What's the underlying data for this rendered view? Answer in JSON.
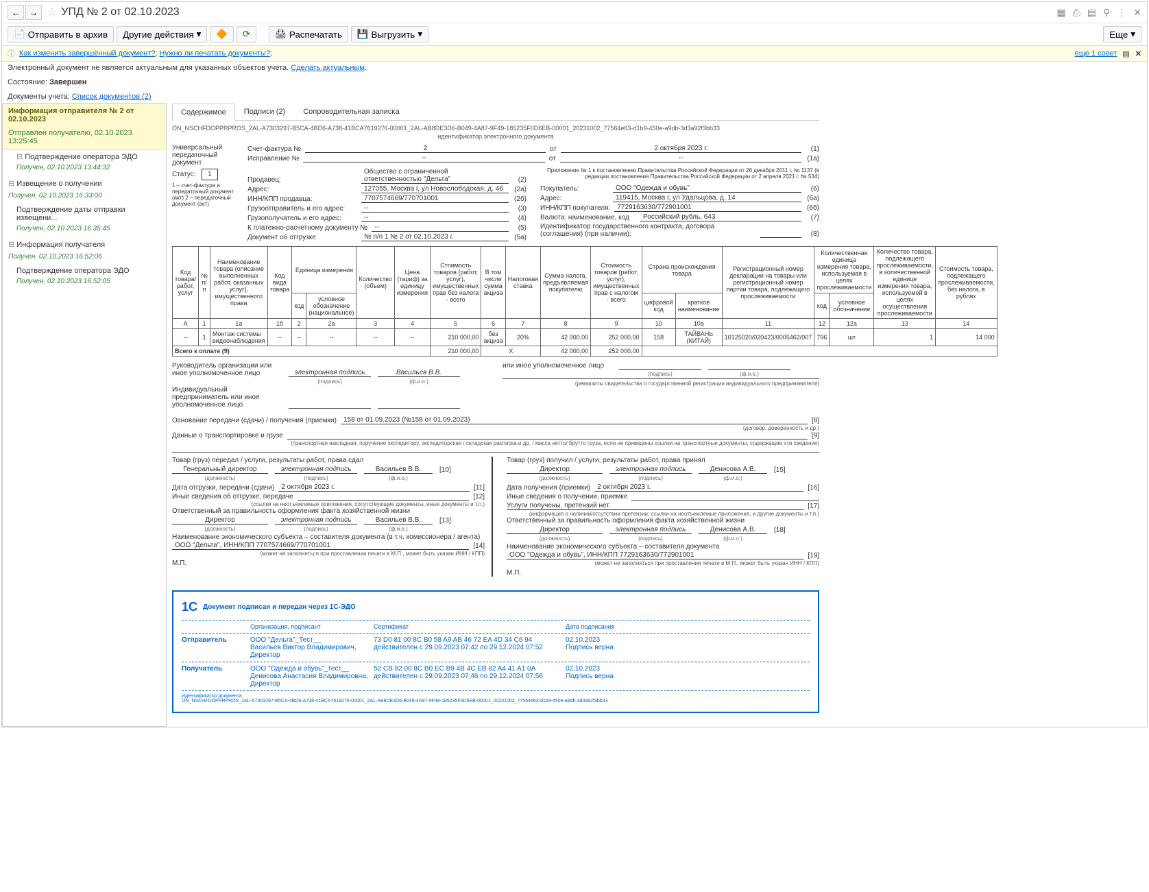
{
  "title": "УПД № 2 от 02.10.2023",
  "toolbar": {
    "archive": "Отправить в архив",
    "other": "Другие действия",
    "print": "Распечатать",
    "export": "Выгрузить",
    "more": "Еще"
  },
  "warning": {
    "link1": "Как изменить завершённый документ?",
    "link2": "Нужно ли печатать документы?",
    "right": "еще 1 совет"
  },
  "info_line": {
    "text": "Электронный документ не является актуальным для указанных объектов учета. ",
    "link": "Сделать актуальным"
  },
  "status": {
    "label": "Состояние:",
    "value": "Завершен"
  },
  "docs": {
    "label": "Документы учета:",
    "link": "Список документов (2)"
  },
  "sidebar": {
    "header": "Информация отправителя № 2 от 02.10.2023",
    "sub": "Отправлен получателю, 02.10.2023 13:25:45",
    "items": [
      {
        "title": "Подтверждение оператора ЭДО",
        "time": "Получен, 02.10.2023 13:44:32"
      },
      {
        "title": "Извещение о получении",
        "time": "Получен, 02.10.2023 16:33:00"
      },
      {
        "title": "Подтверждение даты отправки извещени...",
        "time": "Получен, 02.10.2023 16:35:45"
      },
      {
        "title": "Информация получателя",
        "time": "Получен, 02.10.2023 16:52:06"
      },
      {
        "title": "Подтверждение оператора ЭДО",
        "time": "Получен, 02.10.2023 16:52:05"
      }
    ]
  },
  "tabs": [
    "Содержимое",
    "Подписи (2)",
    "Сопроводительная записка"
  ],
  "doc_id": "ON_NSCHFDOPPRPROS_2AL-A7303297-B5CA-4BD6-A738-41BCA7619276-00001_2AL-AB8DE3D6-B049-4A87-9F49-185235F0D6EB-00001_20231002_77564e63-d1b9-450e-a9db-3d3a92f3bb33",
  "doc_id_label": "идентификатор электронного документа",
  "header": {
    "upd_label": "Универсальный передаточный документ",
    "status_label": "Статус:",
    "status_val": "1",
    "status_note": "1 – счет-фактура и передаточный документ (акт) 2 – передаточный документ (акт)",
    "invoice_label": "Счет-фактура №",
    "invoice_num": "2",
    "invoice_date_label": "от",
    "invoice_date": "2 октября 2023 г.",
    "correction_label": "Исправление №",
    "correction_num": "--",
    "correction_date": "--",
    "appendix": "Приложение № 1 к постановлению Правительства Российской Федерации от 26 декабря 2011 г. № 1137 (в редакции постановления Правительства Российской Федерации от 2 апреля 2021 г. № 534)"
  },
  "seller": {
    "label": "Продавец:",
    "name": "Общество с ограниченной ответственностью \"Дельта\"",
    "addr_label": "Адрес:",
    "addr": "127055, Москва г, ул Новослободская, д. 46",
    "inn_label": "ИНН/КПП продавца:",
    "inn": "7707574669/770701001",
    "shipper_label": "Грузоотправитель и его адрес:",
    "shipper": "--",
    "consignee_label": "Грузополучатель и его адрес:",
    "consignee": "--",
    "payment_label": "К платежно-расчетному документу №",
    "payment": "--",
    "shipdoc_label": "Документ об отгрузке",
    "shipdoc": "№ п/п 1 № 2 от 02.10.2023 г."
  },
  "buyer": {
    "label": "Покупатель:",
    "name": "ООО \"Одежда и обувь\"",
    "addr_label": "Адрес:",
    "addr": "119415, Москва г, ул Удальцова, д. 14",
    "inn_label": "ИНН/КПП покупателя:",
    "inn": "7729163630/772901001",
    "currency_label": "Валюта: наименование, код",
    "currency": "Российский рубль, 643",
    "contract_label": "Идентификатор государственного контракта, договора (соглашения) (при наличии):"
  },
  "nums": [
    "(1)",
    "(1а)",
    "(2)",
    "(2а)",
    "(2б)",
    "(3)",
    "(4)",
    "(5)",
    "(5а)",
    "(6)",
    "(6а)",
    "(6б)",
    "(7)",
    "(8)"
  ],
  "table": {
    "headers": {
      "h1": "Код товара/ работ, услуг",
      "h2": "№ п/п",
      "h3": "Наименование товара (описание выполненных работ, оказанных услуг), имущественного права",
      "h4": "Код вида товара",
      "h5": "Единица измерения",
      "h5a": "код",
      "h5b": "условное обозначение (национальное)",
      "h6": "Количество (объем)",
      "h7": "Цена (тариф) за единицу измерения",
      "h8": "Стоимость товаров (работ, услуг), имущественных прав без налога - всего",
      "h9": "В том числе сумма акциза",
      "h10": "Налоговая ставка",
      "h11": "Сумма налога, предъявляемая покупателю",
      "h12": "Стоимость товаров (работ, услуг), имущественных прав с налогом - всего",
      "h13": "Страна происхождения товара",
      "h13a": "цифровой код",
      "h13b": "краткое наименование",
      "h14": "Регистрационный номер декларации на товары или регистрационный номер партии товара, подлежащего прослеживаемости",
      "h15": "Количественная единица измерения товара, используемая в целях прослеживаемости",
      "h15a": "код",
      "h15b": "условное обозначение",
      "h16": "Количество товара, подлежащего прослеживаемости, в количественной единице измерения товара, используемой в целях осуществления прослеживаемости",
      "h17": "Стоимость товара, подлежащего прослеживаемости, без налога, в рублях"
    },
    "cols": [
      "А",
      "1",
      "1а",
      "1б",
      "2",
      "2а",
      "3",
      "4",
      "5",
      "6",
      "7",
      "8",
      "9",
      "10",
      "10а",
      "11",
      "12",
      "12а",
      "13",
      "14"
    ],
    "row": {
      "code": "--",
      "num": "1",
      "name": "Монтаж системы видеонаблюдения",
      "kind": "--",
      "ucode": "--",
      "uname": "--",
      "qty": "--",
      "price": "--",
      "cost": "210 000,00",
      "excise": "без акциза",
      "rate": "20%",
      "tax": "42 000,00",
      "total": "252 000,00",
      "ccode": "158",
      "cname": "ТАЙВАНЬ (КИТАЙ)",
      "decl": "10125020/020423/0005462/007",
      "tcode": "796",
      "tname": "шт",
      "tqty": "1",
      "tcost": "14 000"
    },
    "total_label": "Всего к оплате (9)",
    "total_cost": "210 000,00",
    "total_x": "Х",
    "total_tax": "42 000,00",
    "total_sum": "252 000,00"
  },
  "sign": {
    "head_label": "Руководитель организации или иное уполномоченное лицо",
    "head_sig": "электронная подпись",
    "head_name": "Васильев В.В.",
    "other_label": "или иное уполномоченное лицо",
    "ip_label": "Индивидуальный предприниматель или иное уполномоченное лицо",
    "ip_note": "(реквизиты свидетельства о государственной регистрации индивидуального предпринимателя)",
    "sig_cap": "(подпись)",
    "fio_cap": "(ф.и.о.)"
  },
  "transfer": {
    "basis_label": "Основание передачи (сдачи) / получения (приемки)",
    "basis_val": "158 от 01.09.2023 (№158 от 01.09.2023)",
    "basis_note": "(договор; доверенность и др.)",
    "transport_label": "Данные о транспортировке и грузе",
    "transport_note": "(транспортная накладная, поручение экспедитору, экспедиторская / складская расписка и др. / масса нетто/ брутто груза, если не приведены ссылки на транспортные документы, содержащие эти сведения)",
    "left": {
      "title": "Товар (груз) передал / услуги, результаты работ, права сдал",
      "pos": "Генеральный директор",
      "sig": "электронная подпись",
      "name": "Васильев В.В.",
      "date_label": "Дата отгрузки, передачи (сдачи)",
      "date": "2 октября 2023 г.",
      "other_label": "Иные сведения об отгрузке, передаче",
      "other_note": "(ссылки на неотъемлемые приложения, сопутствующие документы, иные документы и т.п.)",
      "resp_label": "Ответственный за правильность оформления факта хозяйственной жизни",
      "resp_pos": "Директор",
      "resp_sig": "электронная подпись",
      "resp_name": "Васильев В.В.",
      "entity_label": "Наименование экономического субъекта – составителя документа (в т.ч. комиссионера / агента)",
      "entity": "ООО \"Дельта\", ИНН/КПП 7707574669/770701001",
      "entity_note": "(может не заполняться при проставлении печати в М.П., может быть указан ИНН / КПП)",
      "mp": "М.П."
    },
    "right": {
      "title": "Товар (груз) получил / услуги, результаты работ, права принял",
      "pos": "Директор",
      "sig": "электронная подпись",
      "name": "Денисова А.В.",
      "date_label": "Дата получения (приемки)",
      "date": "2 октября 2023 г.",
      "other_label": "Иные сведения о получении, приемке",
      "other2": "Услуги получены, претензий нет.",
      "other_note": "(информация о наличии/отсутствии претензии; ссылки на неотъемлемые приложения, и другие документы и т.п.)",
      "resp_label": "Ответственный за правильность оформления факта хозяйственной жизни",
      "resp_pos": "Директор",
      "resp_sig": "электронная подпись",
      "resp_name": "Денисова А.В.",
      "entity_label": "Наименование экономического субъекта – составителя документа",
      "entity": "ООО \"Одежда и обувь\", ИНН/КПП 7729163630/772901001",
      "entity_note": "(может не заполняться при проставлении печати в М.П., может быть указан ИНН / КПП)",
      "mp": "М.П."
    },
    "nums": [
      "[8]",
      "[9]",
      "[10]",
      "[11]",
      "[12]",
      "[13]",
      "[14]",
      "[15]",
      "[16]",
      "[17]",
      "[18]",
      "[19]"
    ],
    "pos_cap": "(должность)",
    "sig_cap": "(подпись)",
    "fio_cap": "(ф.и.о.)"
  },
  "sigbox": {
    "title": "Документ подписан и передан через 1С-ЭДО",
    "h_org": "Организация, подписант",
    "h_cert": "Сертификат",
    "h_date": "Дата подписания",
    "sender_label": "Отправитель",
    "sender_org": "ООО \"Дельта\"_Тест__",
    "sender_person": "Васильев Виктор Владимирович, Директор",
    "sender_cert": "73 D0 81 00 8C B0 58 A9 AB 46 72 EA 4D 34 C6 94",
    "sender_valid": "действителен с 29.09.2023 07:42 по 29.12.2024 07:52",
    "sender_date": "02.10.2023",
    "sender_ok": "Подпись верна",
    "recip_label": "Получатель",
    "recip_org": "ООО \"Одежда и обувь\"_тест__",
    "recip_person": "Денисова Анастасия Владимировна, Директор",
    "recip_cert": "52 CB 82 00 8C B0 EC B9 4B 4C EB 82 A4 41 A1 0A",
    "recip_valid": "действителен с 29.09.2023 07:46 по 29.12.2024 07:56",
    "recip_date": "02.10.2023",
    "recip_ok": "Подпись верна",
    "id_label": "Идентификатор документа",
    "id": "ON_NSCHFDOPPRPROS_2AL-A7303297-B5CA-4BD6-A738-41BCA7619276-00001_2AL-AB8DE3D6-B049-4A87-9F49-185235F0D6EB-00001_20231002_77564e63-d1b9-450e-a9db-3d3a92f3bb33"
  }
}
